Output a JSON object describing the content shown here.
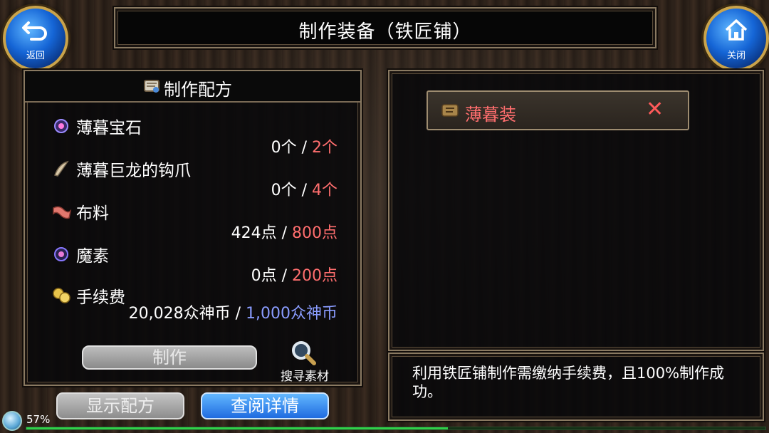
{
  "header": {
    "title": "制作装备（铁匠铺）"
  },
  "nav": {
    "back_label": "返回",
    "close_label": "关闭",
    "back_icon": "return-arrow-icon",
    "close_icon": "home-icon"
  },
  "recipe": {
    "title": "制作配方",
    "materials": [
      {
        "name": "薄暮宝石",
        "have": "0个",
        "need": "2个",
        "icon": "gem-icon"
      },
      {
        "name": "薄暮巨龙的钩爪",
        "have": "0个",
        "need": "4个",
        "icon": "claw-icon"
      },
      {
        "name": "布料",
        "have": "424点",
        "need": "800点",
        "icon": "cloth-icon"
      },
      {
        "name": "魔素",
        "have": "0点",
        "need": "200点",
        "icon": "mana-orb-icon"
      },
      {
        "name": "手续费",
        "have": "20,028众神币",
        "need": "1,000众神币",
        "icon": "coins-icon"
      }
    ],
    "make_label": "制作",
    "search_label": "搜寻素材"
  },
  "bottom": {
    "show_recipe_label": "显示配方",
    "view_detail_label": "查阅详情"
  },
  "result": {
    "item_name": "薄暮装",
    "remove_symbol": "✕"
  },
  "description": "利用铁匠铺制作需缴纳手续费，且100%制作成功。",
  "status": {
    "percent": "57%",
    "exp_fill": 0.57
  },
  "colors": {
    "need": "#ff6e6e",
    "need_blue": "#8a9cff",
    "accent_blue": "#1f6be0"
  }
}
